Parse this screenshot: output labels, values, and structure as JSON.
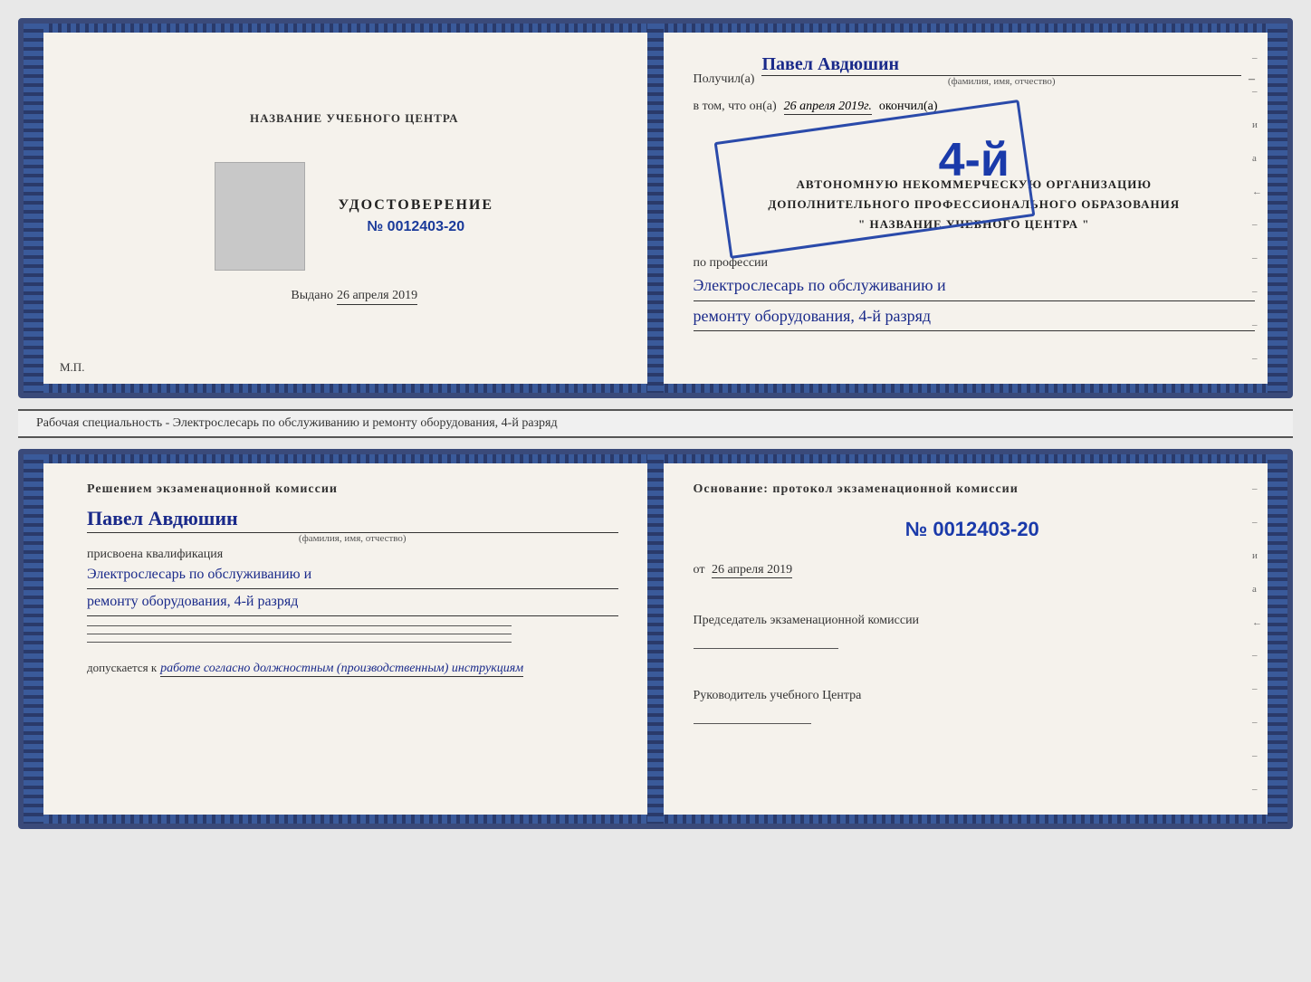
{
  "top_doc": {
    "left": {
      "center_title": "НАЗВАНИЕ УЧЕБНОГО ЦЕНТРА",
      "cert_title": "УДОСТОВЕРЕНИЕ",
      "cert_number": "№ 0012403-20",
      "issued_label": "Выдано",
      "issued_date": "26 апреля 2019",
      "mp_label": "М.П."
    },
    "right": {
      "received_label": "Получил(а)",
      "received_name": "Павел Авдюшин",
      "fio_label": "(фамилия, имя, отчество)",
      "in_that_label": "в том, что он(а)",
      "finished_date": "26 апреля 2019г.",
      "finished_label": "окончил(а)",
      "big_number": "4-й",
      "org_line1": "АВТОНОМНУЮ НЕКОММЕРЧЕСКУЮ ОРГАНИЗАЦИЮ",
      "org_line2": "ДОПОЛНИТЕЛЬНОГО ПРОФЕССИОНАЛЬНОГО ОБРАЗОВАНИЯ",
      "org_line3": "\" НАЗВАНИЕ УЧЕБНОГО ЦЕНТРА \"",
      "profession_label": "по профессии",
      "profession_line1": "Электрослесарь по обслуживанию и",
      "profession_line2": "ремонту оборудования, 4-й разряд"
    }
  },
  "middle_label": {
    "text": "Рабочая специальность - Электрослесарь по обслуживанию и ремонту оборудования, 4-й разряд"
  },
  "bottom_doc": {
    "left": {
      "commission_title": "Решением экзаменационной комиссии",
      "person_name": "Павел Авдюшин",
      "fio_label": "(фамилия, имя, отчество)",
      "assigned_label": "присвоена квалификация",
      "qual_line1": "Электрослесарь по обслуживанию и",
      "qual_line2": "ремонту оборудования, 4-й разряд",
      "allows_label": "допускается к",
      "allows_value": "работе согласно должностным (производственным) инструкциям"
    },
    "right": {
      "basis_title": "Основание: протокол экзаменационной комиссии",
      "protocol_number": "№ 0012403-20",
      "from_label": "от",
      "from_date": "26 апреля 2019",
      "chairman_label": "Председатель экзаменационной комиссии",
      "director_label": "Руководитель учебного Центра"
    }
  },
  "right_deco": {
    "letters": "и а ← – – – – –"
  }
}
